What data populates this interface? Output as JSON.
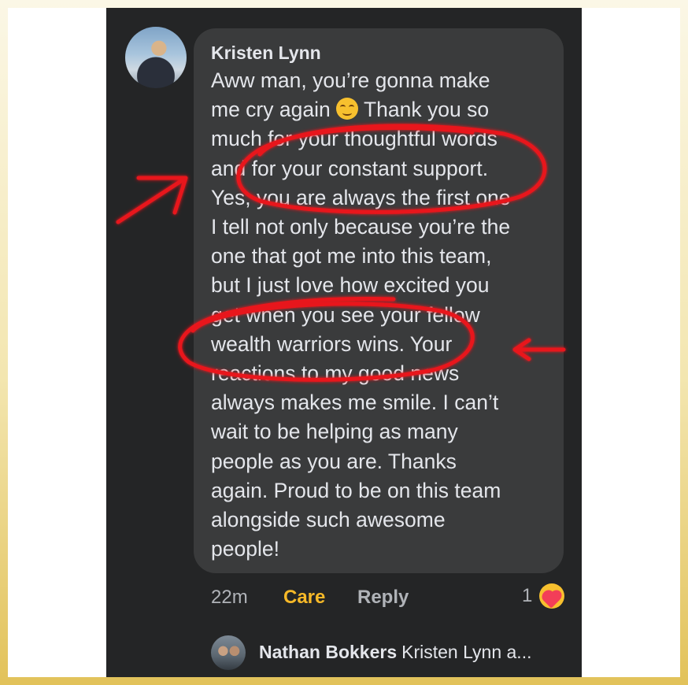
{
  "comment": {
    "author": "Kristen Lynn",
    "lines": [
      "Aww man, you’re gonna make",
      "me cry again",
      " Thank you so",
      "much for your thoughtful words",
      "and for your constant support.",
      "Yes, you are always the first one",
      "I tell not only because you’re the",
      "one that got me into this team,",
      "but I just love how excited you",
      "get when you see your fellow",
      "wealth warriors wins. Your",
      "reactions to my good news",
      "always makes me smile. I can’t",
      "wait to be helping as many",
      "people as you are. Thanks",
      "again. Proud to be on this team",
      "alongside such awesome",
      "people!"
    ],
    "emoji_icon": "smiling-face-emoji",
    "time": "22m",
    "reaction_label": "Care",
    "reply_label": "Reply",
    "reaction_count": "1",
    "reaction_icon": "care-reaction-icon"
  },
  "reply_preview": {
    "author": "Nathan Bokkers",
    "snippet": "Kristen Lynn a..."
  },
  "colors": {
    "bubble": "#3a3b3c",
    "background": "#242526",
    "care_accent": "#f7b928",
    "annotation_red": "#e8141b"
  }
}
